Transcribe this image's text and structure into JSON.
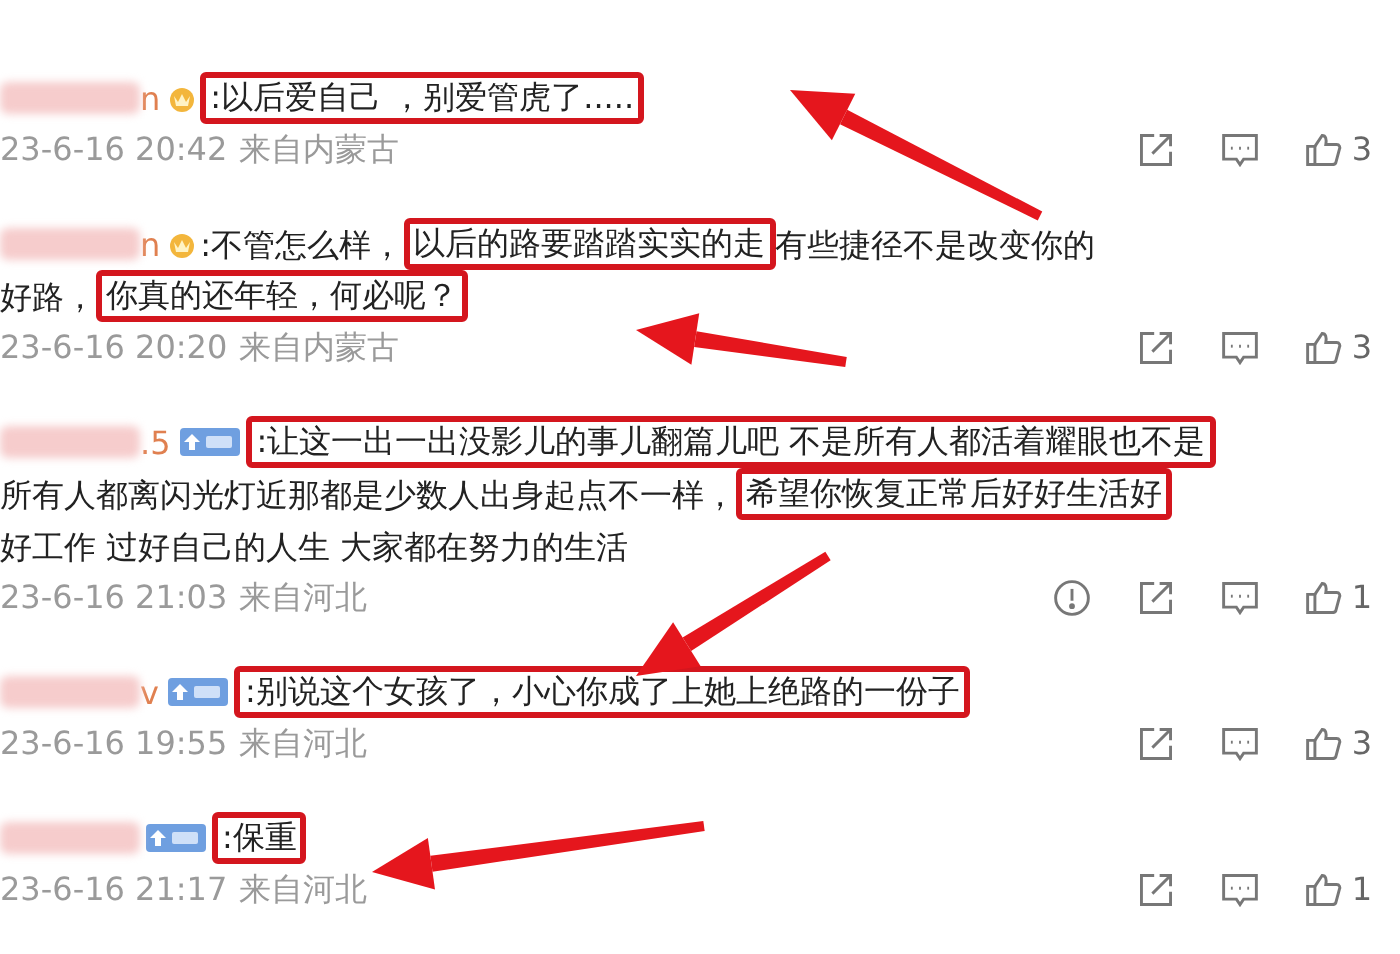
{
  "comments": [
    {
      "name_tail": "n",
      "kind": "crown",
      "lines": [
        [
          {
            "text": ":以后爱自己 ，别爱管虎了.....",
            "highlighted": true
          }
        ]
      ],
      "time": "23-6-16 20:42",
      "location": "来自内蒙古",
      "actions": [
        {
          "kind": "share"
        },
        {
          "kind": "comment"
        },
        {
          "kind": "like",
          "count": "3"
        }
      ]
    },
    {
      "name_tail": "n",
      "kind": "crown",
      "lines": [
        [
          {
            "text": ":不管怎么样，",
            "highlighted": false
          },
          {
            "text": "以后的路要踏踏实实的走",
            "highlighted": true
          },
          {
            "text": " 有些捷径不是改变你的",
            "highlighted": false
          }
        ],
        [
          {
            "text": "好路，",
            "highlighted": false
          },
          {
            "text": "你真的还年轻，何必呢？",
            "highlighted": true
          }
        ]
      ],
      "time": "23-6-16 20:20",
      "location": "来自内蒙古",
      "actions": [
        {
          "kind": "share"
        },
        {
          "kind": "comment"
        },
        {
          "kind": "like",
          "count": "3"
        }
      ]
    },
    {
      "name_tail": ".5",
      "kind": "fan",
      "lines": [
        [
          {
            "text": ":让这一出一出没影儿的事儿翻篇儿吧 不是所有人都活着耀眼也不是",
            "highlighted": true
          }
        ],
        [
          {
            "text": "所有人都离闪光灯近那都是少数人出身起点不一样，",
            "highlighted": false
          },
          {
            "text": "希望你恢复正常后好好生活好",
            "highlighted": true
          }
        ],
        [
          {
            "text": "好工作 过好自己的人生 大家都在努力的生活",
            "highlighted": false
          }
        ]
      ],
      "time": "23-6-16 21:03",
      "location": "来自河北",
      "actions": [
        {
          "kind": "report"
        },
        {
          "kind": "share"
        },
        {
          "kind": "comment"
        },
        {
          "kind": "like",
          "count": "1"
        }
      ]
    },
    {
      "name_tail": "v",
      "kind": "fan",
      "lines": [
        [
          {
            "text": ":别说这个女孩了，小心你成了上她上绝路的一份子",
            "highlighted": true
          }
        ]
      ],
      "time": "23-6-16 19:55",
      "location": "来自河北",
      "actions": [
        {
          "kind": "share"
        },
        {
          "kind": "comment"
        },
        {
          "kind": "like",
          "count": "3"
        }
      ]
    },
    {
      "kind": "fan",
      "lines": [
        [
          {
            "text": ":保重",
            "highlighted": true
          }
        ]
      ],
      "time": "23-6-16 21:17",
      "location": "来自河北",
      "actions": [
        {
          "kind": "share"
        },
        {
          "kind": "comment"
        },
        {
          "kind": "like",
          "count": "1"
        }
      ]
    }
  ]
}
